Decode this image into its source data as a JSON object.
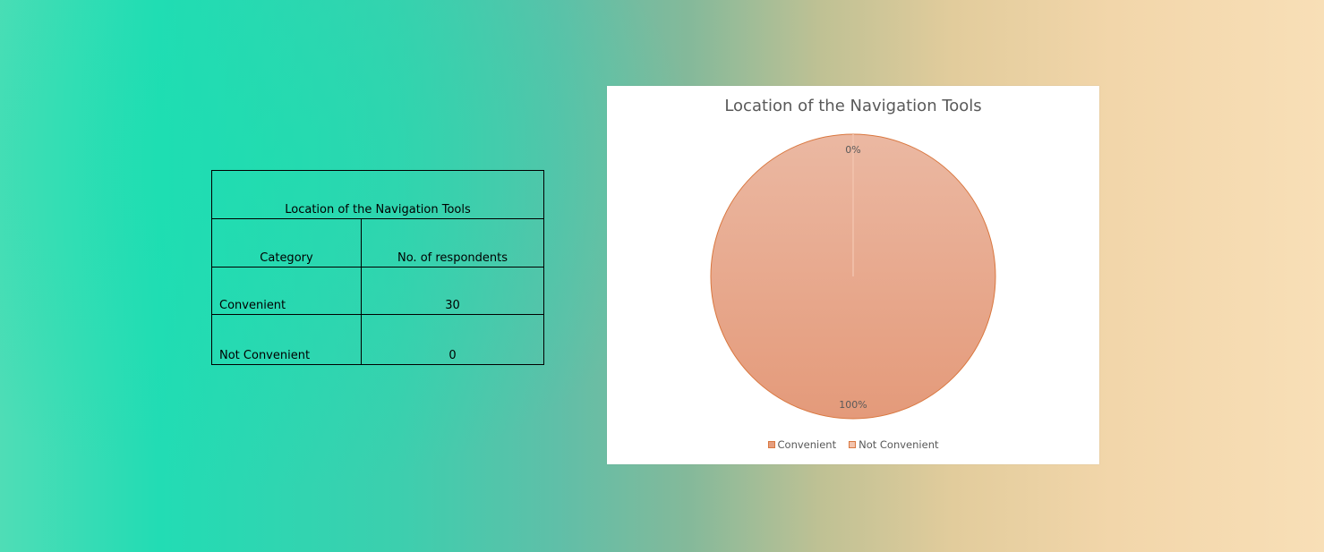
{
  "table": {
    "title": "Location of the Navigation Tools",
    "headers": [
      "Category",
      "No. of respondents"
    ],
    "rows": [
      [
        "Convenient",
        "30"
      ],
      [
        "Not Convenient",
        "0"
      ]
    ]
  },
  "chart_data": {
    "type": "pie",
    "title": "Location of the Navigation Tools",
    "categories": [
      "Convenient",
      "Not Convenient"
    ],
    "values": [
      30,
      0
    ],
    "data_labels": [
      "100%",
      "0%"
    ],
    "colors": [
      "#e59e7f",
      "#f2c3ad"
    ],
    "stroke_color": "#d9773f",
    "legend_position": "bottom"
  }
}
